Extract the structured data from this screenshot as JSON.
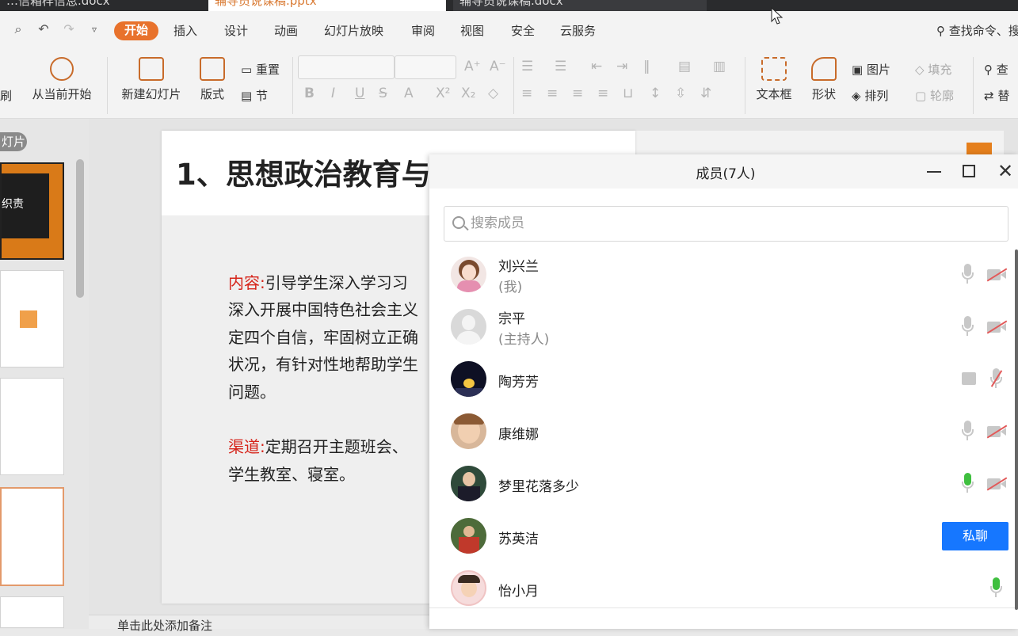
{
  "tabs": [
    {
      "label": "…信箱样信息.docx",
      "active": false
    },
    {
      "label": "辅导员说课稿.pptx",
      "active": true
    },
    {
      "label": "辅导员说课稿.docx",
      "active": false
    }
  ],
  "menu": {
    "items": [
      "开始",
      "插入",
      "设计",
      "动画",
      "幻灯片放映",
      "审阅",
      "视图",
      "安全",
      "云服务"
    ],
    "search_label": "查找命令、搜"
  },
  "ribbon": {
    "copy_label": "刷",
    "from_current": "从当前开始",
    "new_slide": "新建幻灯片",
    "layout": "版式",
    "reset": "重置",
    "section": "节",
    "textbox": "文本框",
    "shape": "形状",
    "picture": "图片",
    "arrange": "排列",
    "fill": "填充",
    "outline": "轮廓",
    "find": "查",
    "replace": "替"
  },
  "side_panel": {
    "tab_label": "灯片",
    "thumb1_text": "织责"
  },
  "slide": {
    "title": "1、思想政治教育与",
    "content_label": "内容:",
    "content_lines": [
      "引导学生深入学习习",
      "深入开展中国特色社会主义",
      "定四个自信，牢固树立正确",
      "状况，有针对性地帮助学生",
      "问题。"
    ],
    "channel_label": "渠道:",
    "channel_lines": [
      "定期召开主题班会、",
      "学生教室、寝室。"
    ]
  },
  "notes_placeholder": "单击此处添加备注",
  "dialog": {
    "title": "成员(7人)",
    "search_placeholder": "搜索成员",
    "private_chat_label": "私聊",
    "members": [
      {
        "name": "刘兴兰",
        "role": "(我)",
        "mic": "off",
        "camera": "off"
      },
      {
        "name": "宗平",
        "role": "(主持人)",
        "mic": "off",
        "camera": "off"
      },
      {
        "name": "陶芳芳",
        "role": "",
        "mic": "muted",
        "camera": "screen"
      },
      {
        "name": "康维娜",
        "role": "",
        "mic": "off",
        "camera": "off"
      },
      {
        "name": "梦里花落多少",
        "role": "",
        "mic": "on",
        "camera": "off"
      },
      {
        "name": "苏英洁",
        "role": "",
        "mic": "",
        "camera": ""
      },
      {
        "name": "怡小月",
        "role": "",
        "mic": "on",
        "camera": ""
      }
    ]
  },
  "colors": {
    "accent": "#e8722c",
    "primary_button": "#1677ff",
    "slide_label": "#d6241a",
    "mic_active": "#3fbf3f"
  }
}
